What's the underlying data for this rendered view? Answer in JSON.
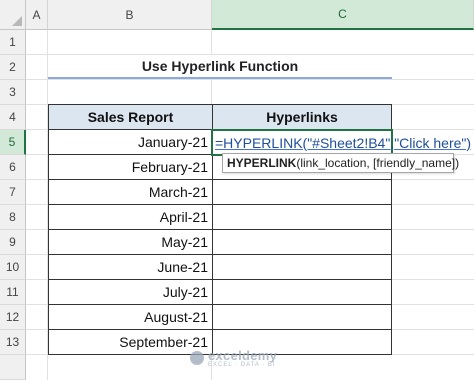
{
  "columns": [
    "A",
    "B",
    "C"
  ],
  "rows": [
    "1",
    "2",
    "3",
    "4",
    "5",
    "6",
    "7",
    "8",
    "9",
    "10",
    "11",
    "12",
    "13"
  ],
  "title": "Use Hyperlink Function",
  "table": {
    "headers": [
      "Sales Report",
      "Hyperlinks"
    ],
    "months": [
      "January-21",
      "February-21",
      "March-21",
      "April-21",
      "May-21",
      "June-21",
      "July-21",
      "August-21",
      "September-21"
    ]
  },
  "active_cell": {
    "column": "C",
    "row": "5"
  },
  "formula_text": "=HYPERLINK(\"#Sheet2!B4\",\"Click here\")",
  "tooltip": {
    "function": "HYPERLINK",
    "args": "(link_location, [friendly_name])"
  },
  "watermark": {
    "name": "exceldemy",
    "tagline": "EXCEL · DATA · BI"
  },
  "colors": {
    "excel_green": "#217346",
    "header_fill": "#dce6f1",
    "title_underline": "#8ea9db"
  }
}
